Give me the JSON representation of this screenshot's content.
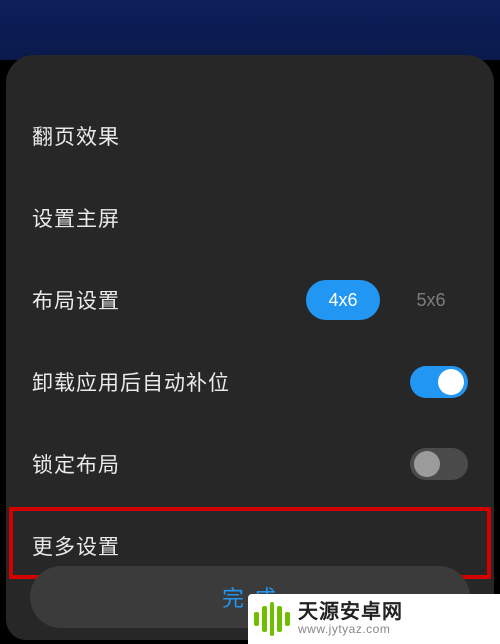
{
  "colors": {
    "accent": "#2196f3",
    "sheet_bg": "#272727",
    "highlight_border": "#d40000",
    "watermark_green": "#6fbf00"
  },
  "rows": {
    "page_effect": {
      "label": "翻页效果"
    },
    "set_home": {
      "label": "设置主屏"
    },
    "layout": {
      "label": "布局设置",
      "options": [
        "4x6",
        "5x6"
      ],
      "selected": "4x6"
    },
    "auto_fill": {
      "label": "卸载应用后自动补位",
      "toggle": true
    },
    "lock_layout": {
      "label": "锁定布局",
      "toggle": false
    },
    "more": {
      "label": "更多设置"
    }
  },
  "done_button": {
    "label": "完 成"
  },
  "watermark": {
    "title": "天源安卓网",
    "sub": "www.jytyaz.com"
  }
}
